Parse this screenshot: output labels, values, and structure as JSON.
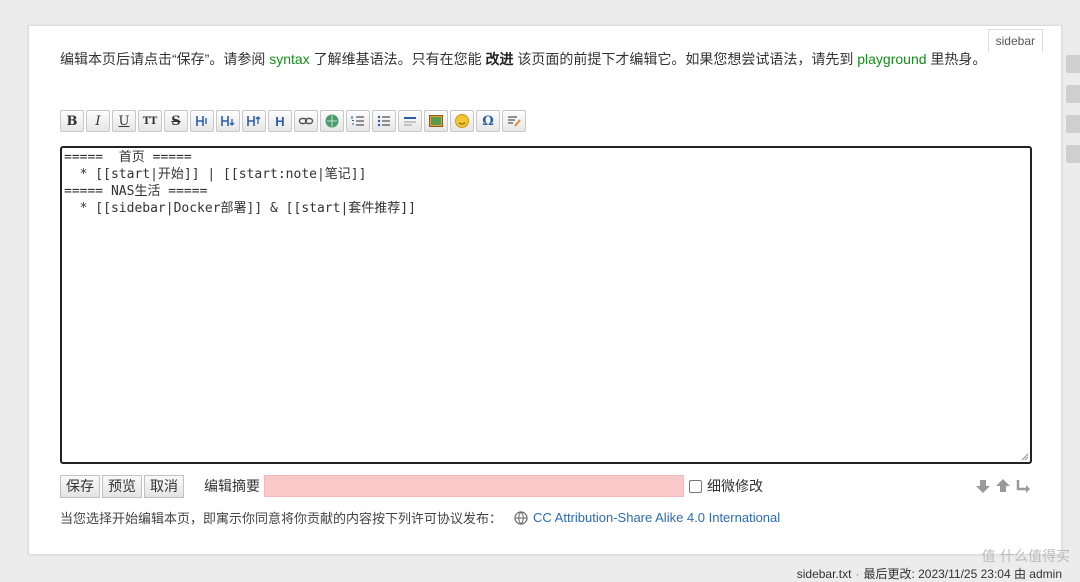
{
  "page_id_tab": "sidebar",
  "intro": {
    "part1": "编辑本页后请点击“保存”。请参阅 ",
    "syntax_link": "syntax",
    "part2": " 了解维基语法。只有在您能 ",
    "bold": "改进",
    "part3": " 该页面的前提下才编辑它。如果您想尝试语法，请先到 ",
    "playground_link": "playground",
    "part4": " 里热身。"
  },
  "toolbar": {
    "buttons": [
      {
        "name": "bold-button",
        "label": "B",
        "icon": "bold"
      },
      {
        "name": "italic-button",
        "label": "I",
        "icon": "italic"
      },
      {
        "name": "underline-button",
        "label": "U",
        "icon": "underline"
      },
      {
        "name": "code-button",
        "label": "TT",
        "icon": "monospace"
      },
      {
        "name": "strike-button",
        "label": "S",
        "icon": "strikethrough"
      },
      {
        "name": "heading-same-button",
        "label": "",
        "icon": "heading-same"
      },
      {
        "name": "heading-lower-button",
        "label": "",
        "icon": "heading-lower"
      },
      {
        "name": "heading-higher-button",
        "label": "",
        "icon": "heading-higher"
      },
      {
        "name": "heading-menu-button",
        "label": "H",
        "icon": "heading-menu"
      },
      {
        "name": "internal-link-button",
        "label": "",
        "icon": "link"
      },
      {
        "name": "external-link-button",
        "label": "",
        "icon": "globe-link"
      },
      {
        "name": "ordered-list-button",
        "label": "",
        "icon": "ordered-list"
      },
      {
        "name": "unordered-list-button",
        "label": "",
        "icon": "unordered-list"
      },
      {
        "name": "hr-button",
        "label": "",
        "icon": "horizontal-rule"
      },
      {
        "name": "media-button",
        "label": "",
        "icon": "image"
      },
      {
        "name": "smiley-button",
        "label": "",
        "icon": "smiley"
      },
      {
        "name": "special-chars-button",
        "label": "Ω",
        "icon": "omega"
      },
      {
        "name": "signature-button",
        "label": "",
        "icon": "signature"
      }
    ]
  },
  "editor": {
    "content": "=====  首页 =====\n  * [[start|开始]] | [[start:note|笔记]]\n===== NAS生活 =====\n  * [[sidebar|Docker部署]] & [[start|套件推荐]]"
  },
  "controls": {
    "save": "保存",
    "preview": "预览",
    "cancel": "取消",
    "summary_label": "编辑摘要",
    "summary_value": "",
    "minor_label": "细微修改"
  },
  "license": {
    "text": "当您选择开始编辑本页，即寓示你同意将你贡献的内容按下列许可协议发布：",
    "link": "CC Attribution-Share Alike 4.0 International"
  },
  "footer": {
    "file": "sidebar.txt",
    "sep": "·",
    "last_modified": "最后更改: 2023/11/25 23:04 由 admin"
  },
  "watermark": "值 什么值得买",
  "colors": {
    "link_green": "#158d1a",
    "license_blue": "#2b6cb0",
    "summary_bg": "#f9c9c9"
  }
}
